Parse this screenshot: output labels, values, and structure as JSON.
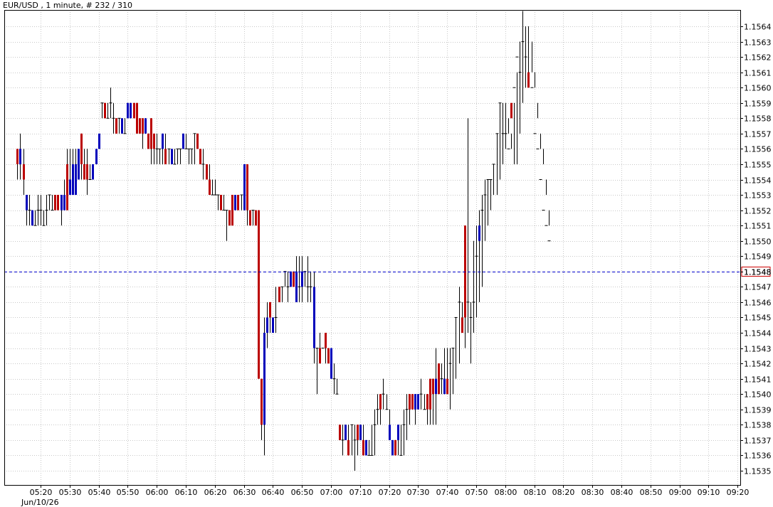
{
  "chart_data": {
    "type": "candlestick",
    "title": "EUR/USD , 1 minute, # 232 / 310",
    "instrument": "EUR/USD",
    "timeframe": "1 minute",
    "date_label": "Jun/10/26",
    "ylim": [
      1.15345,
      1.15654
    ],
    "y_ticks": [
      "1.1564",
      "1.1563",
      "1.1562",
      "1.1561",
      "1.1560",
      "1.1559",
      "1.1558",
      "1.1557",
      "1.1556",
      "1.1555",
      "1.1554",
      "1.1553",
      "1.1552",
      "1.1551",
      "1.1550",
      "1.1549",
      "1.1548",
      "1.1547",
      "1.1546",
      "1.1545",
      "1.1544",
      "1.1543",
      "1.1542",
      "1.1541",
      "1.1540",
      "1.1539",
      "1.1538",
      "1.1537",
      "1.1536",
      "1.1535"
    ],
    "x_ticks": [
      "05:20",
      "05:30",
      "05:40",
      "05:50",
      "06:00",
      "06:10",
      "06:20",
      "06:30",
      "06:40",
      "06:50",
      "07:00",
      "07:10",
      "07:20",
      "07:30",
      "07:40",
      "07:50",
      "08:00",
      "08:10",
      "08:20",
      "08:30",
      "08:40",
      "08:50",
      "09:00",
      "09:10",
      "09:20"
    ],
    "current_price": "1.1548",
    "grid": true,
    "colors": {
      "up": "#0000bb",
      "down": "#bb0000",
      "grid": "#c8c8c8",
      "price_line": "#0000cc",
      "price_label": "#cc0000"
    },
    "candles": {
      "start": "05:12",
      "interval_minutes": 1,
      "open": [
        1.1556,
        1.1555,
        1.1555,
        1.1552,
        1.1552,
        1.1551,
        1.1551,
        1.1552,
        1.1552,
        1.1551,
        1.1552,
        1.1553,
        1.1552,
        1.1553,
        1.1553,
        1.1552,
        1.1552,
        1.1555,
        1.1553,
        1.1553,
        1.1553,
        1.1554,
        1.1557,
        1.1555,
        1.1555,
        1.1554,
        1.1554,
        1.1555,
        1.1556,
        1.1559,
        1.1559,
        1.1558,
        1.1559,
        1.1558,
        1.1558,
        1.1558,
        1.1557,
        1.1557,
        1.1558,
        1.1558,
        1.1559,
        1.1559,
        1.1558,
        1.1558,
        1.1557,
        1.1557,
        1.1558,
        1.1557,
        1.1556,
        1.1556,
        1.1556,
        1.1556,
        1.1556,
        1.1555,
        1.1555,
        1.1556,
        1.1556,
        1.1556,
        1.1556,
        1.1556,
        1.1556,
        1.1557,
        1.1557,
        1.1556,
        1.1555,
        1.1555,
        1.1554,
        1.1553,
        1.1553,
        1.1553,
        1.1553,
        1.1552,
        1.1552,
        1.1552,
        1.1553,
        1.1552,
        1.1553,
        1.1553,
        1.1552,
        1.1555,
        1.1552,
        1.1552,
        1.1552,
        1.1552,
        1.1541,
        1.1538,
        1.1544,
        1.1546,
        1.1544,
        1.1545,
        1.1547,
        1.1547,
        1.1548,
        1.1547,
        1.1547,
        1.1548,
        1.1546,
        1.1547,
        1.1547,
        1.1548,
        1.1547,
        1.1547,
        1.1543,
        1.1543,
        1.1543,
        1.1543,
        1.1544,
        1.1543,
        1.1541,
        1.1541,
        1.154,
        1.1538,
        1.1537,
        1.1537,
        1.1537,
        1.1538,
        1.1537,
        1.1538,
        1.1537,
        1.1537,
        1.1536,
        1.1536,
        1.1536,
        1.1538,
        1.1539,
        1.154,
        1.154,
        1.1539,
        1.1537,
        1.1536,
        1.1537,
        1.1537,
        1.1536,
        1.1538,
        1.1539,
        1.154,
        1.154,
        1.1539,
        1.1539,
        1.154,
        1.1539,
        1.154,
        1.1541,
        1.1541,
        1.154,
        1.1542,
        1.1541,
        1.154,
        1.1541,
        1.1542,
        1.1543,
        1.1545,
        1.1546,
        1.1545,
        1.1551,
        1.1546,
        1.1545,
        1.1546,
        1.1549,
        1.155,
        1.1552,
        1.1553,
        1.1554,
        1.1554,
        1.1555,
        1.1557,
        1.1559,
        1.1557,
        1.1557,
        1.1556,
        1.1559,
        1.156,
        1.1562,
        1.1561,
        1.1563,
        1.1562,
        1.1561,
        1.156,
        1.1557,
        1.1556,
        1.1554,
        1.1552,
        1.1551,
        1.155
      ],
      "close": [
        1.1555,
        1.1556,
        1.1554,
        1.1553,
        1.1552,
        1.1552,
        1.1551,
        1.1552,
        1.1552,
        1.1551,
        1.1552,
        1.1553,
        1.1552,
        1.1552,
        1.1552,
        1.1553,
        1.1553,
        1.1552,
        1.1554,
        1.1555,
        1.1555,
        1.1556,
        1.1555,
        1.1554,
        1.1554,
        1.1554,
        1.1555,
        1.1556,
        1.1557,
        1.1559,
        1.1558,
        1.1558,
        1.1559,
        1.1558,
        1.1557,
        1.1558,
        1.1558,
        1.1557,
        1.1559,
        1.1559,
        1.1558,
        1.1557,
        1.1557,
        1.1557,
        1.1558,
        1.1556,
        1.1556,
        1.1556,
        1.1556,
        1.1556,
        1.1557,
        1.1555,
        1.1556,
        1.1556,
        1.1555,
        1.1556,
        1.1556,
        1.1557,
        1.1556,
        1.1556,
        1.1556,
        1.1557,
        1.1556,
        1.1555,
        1.1555,
        1.1554,
        1.1553,
        1.1553,
        1.1553,
        1.1553,
        1.1552,
        1.1552,
        1.1552,
        1.1551,
        1.1551,
        1.1553,
        1.1552,
        1.1553,
        1.1555,
        1.1552,
        1.1551,
        1.1552,
        1.1551,
        1.1541,
        1.1538,
        1.1544,
        1.1545,
        1.1545,
        1.1545,
        1.1545,
        1.1546,
        1.1547,
        1.1548,
        1.1547,
        1.1548,
        1.1547,
        1.1548,
        1.1547,
        1.1548,
        1.1548,
        1.1547,
        1.1547,
        1.1547,
        1.1543,
        1.1542,
        1.1543,
        1.1543,
        1.1542,
        1.1543,
        1.1541,
        1.154,
        1.1537,
        1.1537,
        1.1538,
        1.1536,
        1.1538,
        1.1537,
        1.1537,
        1.1538,
        1.1536,
        1.1537,
        1.1536,
        1.1536,
        1.1538,
        1.1539,
        1.1539,
        1.154,
        1.1539,
        1.1538,
        1.1537,
        1.1536,
        1.1538,
        1.1536,
        1.1538,
        1.1539,
        1.1539,
        1.1539,
        1.154,
        1.154,
        1.154,
        1.1539,
        1.1539,
        1.1539,
        1.154,
        1.1541,
        1.154,
        1.1541,
        1.1541,
        1.154,
        1.1542,
        1.1543,
        1.1545,
        1.1546,
        1.1544,
        1.1545,
        1.1546,
        1.1545,
        1.1546,
        1.1549,
        1.1551,
        1.1552,
        1.1553,
        1.1554,
        1.1554,
        1.1555,
        1.1557,
        1.1559,
        1.1557,
        1.1557,
        1.1556,
        1.1558,
        1.156,
        1.1562,
        1.1561,
        1.1563,
        1.1562,
        1.156,
        1.156,
        1.1557,
        1.1556,
        1.1554,
        1.1552,
        1.1551,
        1.155,
        1.1548
      ],
      "high": [
        1.1556,
        1.1557,
        1.1556,
        1.1553,
        1.1553,
        1.1552,
        1.1552,
        1.1553,
        1.1553,
        1.1552,
        1.1553,
        1.1553,
        1.1553,
        1.1553,
        1.1553,
        1.1553,
        1.1554,
        1.1556,
        1.1556,
        1.1556,
        1.1556,
        1.1556,
        1.1557,
        1.1556,
        1.1556,
        1.1555,
        1.1555,
        1.1556,
        1.1557,
        1.1559,
        1.1559,
        1.1559,
        1.156,
        1.1559,
        1.1558,
        1.1558,
        1.1558,
        1.1558,
        1.1559,
        1.1559,
        1.1559,
        1.1559,
        1.1558,
        1.1558,
        1.1558,
        1.1557,
        1.1558,
        1.1557,
        1.1557,
        1.1556,
        1.1557,
        1.1557,
        1.1556,
        1.1556,
        1.1556,
        1.1556,
        1.1556,
        1.1557,
        1.1557,
        1.1556,
        1.1556,
        1.1557,
        1.1557,
        1.1556,
        1.1556,
        1.1555,
        1.1555,
        1.1554,
        1.1554,
        1.1553,
        1.1553,
        1.1553,
        1.1552,
        1.1552,
        1.1553,
        1.1553,
        1.1553,
        1.1553,
        1.1555,
        1.1555,
        1.1552,
        1.1552,
        1.1552,
        1.1552,
        1.1541,
        1.1545,
        1.1546,
        1.1546,
        1.1545,
        1.1547,
        1.1547,
        1.1547,
        1.1548,
        1.1548,
        1.1548,
        1.1548,
        1.1549,
        1.1549,
        1.1549,
        1.1548,
        1.1549,
        1.1548,
        1.1548,
        1.1543,
        1.1544,
        1.1543,
        1.1544,
        1.1543,
        1.1543,
        1.1542,
        1.1541,
        1.1538,
        1.1538,
        1.1538,
        1.1538,
        1.1538,
        1.1538,
        1.1538,
        1.1538,
        1.1538,
        1.1537,
        1.1537,
        1.1538,
        1.1539,
        1.154,
        1.154,
        1.1541,
        1.154,
        1.1539,
        1.1537,
        1.1537,
        1.1538,
        1.1538,
        1.1539,
        1.154,
        1.154,
        1.154,
        1.154,
        1.154,
        1.1541,
        1.154,
        1.154,
        1.154,
        1.1541,
        1.1543,
        1.1542,
        1.1542,
        1.1543,
        1.1543,
        1.1543,
        1.1543,
        1.1545,
        1.1547,
        1.1546,
        1.1546,
        1.1558,
        1.1546,
        1.155,
        1.1551,
        1.1552,
        1.1553,
        1.1554,
        1.1554,
        1.1554,
        1.1555,
        1.1557,
        1.1559,
        1.1559,
        1.1559,
        1.1558,
        1.1557,
        1.1559,
        1.1561,
        1.1563,
        1.1565,
        1.1564,
        1.1564,
        1.1563,
        1.1561,
        1.1558,
        1.1557,
        1.1556,
        1.1554,
        1.1552,
        1.1551,
        1.1549
      ],
      "low": [
        1.1554,
        1.1554,
        1.1553,
        1.1551,
        1.1551,
        1.1551,
        1.1551,
        1.1551,
        1.1551,
        1.1551,
        1.1551,
        1.1552,
        1.1552,
        1.1552,
        1.1552,
        1.1551,
        1.1552,
        1.1552,
        1.1553,
        1.1553,
        1.1553,
        1.1554,
        1.1554,
        1.1554,
        1.1553,
        1.1554,
        1.1554,
        1.1555,
        1.1556,
        1.1558,
        1.1558,
        1.1558,
        1.1558,
        1.1557,
        1.1557,
        1.1557,
        1.1557,
        1.1557,
        1.1558,
        1.1558,
        1.1558,
        1.1557,
        1.1557,
        1.1556,
        1.1557,
        1.1556,
        1.1555,
        1.1555,
        1.1555,
        1.1555,
        1.1555,
        1.1555,
        1.1555,
        1.1555,
        1.1555,
        1.1555,
        1.1555,
        1.1556,
        1.1556,
        1.1555,
        1.1555,
        1.1555,
        1.1556,
        1.1555,
        1.1554,
        1.1554,
        1.1553,
        1.1553,
        1.1553,
        1.1552,
        1.1552,
        1.1552,
        1.155,
        1.1551,
        1.1551,
        1.1552,
        1.1552,
        1.1552,
        1.1552,
        1.1551,
        1.1551,
        1.1551,
        1.1551,
        1.1541,
        1.1537,
        1.1536,
        1.1543,
        1.1544,
        1.1544,
        1.1544,
        1.1546,
        1.1546,
        1.1547,
        1.1546,
        1.1547,
        1.1547,
        1.1546,
        1.1546,
        1.1546,
        1.1547,
        1.1546,
        1.1546,
        1.1542,
        1.154,
        1.1542,
        1.1543,
        1.1542,
        1.1542,
        1.1541,
        1.154,
        1.154,
        1.1537,
        1.1536,
        1.1537,
        1.1536,
        1.1536,
        1.1535,
        1.1536,
        1.1537,
        1.1536,
        1.1536,
        1.1536,
        1.1536,
        1.1536,
        1.1538,
        1.1538,
        1.1539,
        1.1539,
        1.1538,
        1.1537,
        1.1536,
        1.1536,
        1.1536,
        1.1536,
        1.1537,
        1.1538,
        1.1539,
        1.1538,
        1.1539,
        1.1539,
        1.1539,
        1.1538,
        1.1538,
        1.1538,
        1.1538,
        1.154,
        1.154,
        1.154,
        1.154,
        1.1539,
        1.154,
        1.1541,
        1.1542,
        1.1544,
        1.1543,
        1.1544,
        1.1542,
        1.1544,
        1.1545,
        1.1546,
        1.1547,
        1.155,
        1.1551,
        1.1552,
        1.1553,
        1.1553,
        1.1554,
        1.1555,
        1.1556,
        1.1557,
        1.1556,
        1.1555,
        1.1555,
        1.1557,
        1.1559,
        1.156,
        1.156,
        1.1561,
        1.156,
        1.1559,
        1.1556,
        1.1555,
        1.1553,
        1.1551,
        1.155,
        1.1549,
        1.1548,
        1.1548
      ]
    }
  }
}
